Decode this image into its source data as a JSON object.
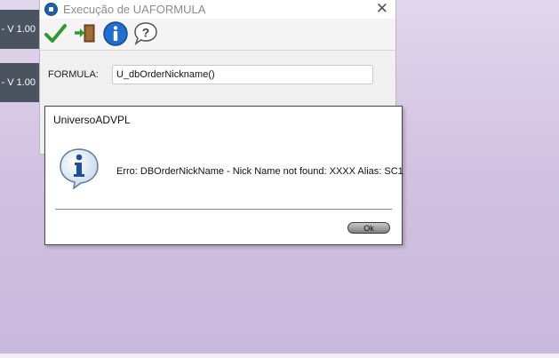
{
  "background": {
    "tiles": [
      {
        "label": "- V 1.00"
      },
      {
        "label": "- V 1.00"
      }
    ]
  },
  "window": {
    "title": "Execução de UAFORMULA",
    "close_symbol": "✕",
    "toolbar": {
      "confirm_icon": "checkmark-icon",
      "exit_icon": "exit-door-icon",
      "info_icon": "info-icon",
      "help_icon": "help-icon"
    },
    "form": {
      "label": "FORMULA:",
      "value": "U_dbOrderNickname()"
    }
  },
  "dialog": {
    "title": "UniversoADVPL",
    "icon": "info-bubble-icon",
    "message": "Erro: DBOrderNickName - Nick Name not found: XXXX Alias: SC1",
    "ok_label": "Ok"
  },
  "colors": {
    "background": "#d6c9e6",
    "tile": "#4a5360",
    "info_blue": "#1f6fd0",
    "confirm_green": "#2e9a2e"
  }
}
